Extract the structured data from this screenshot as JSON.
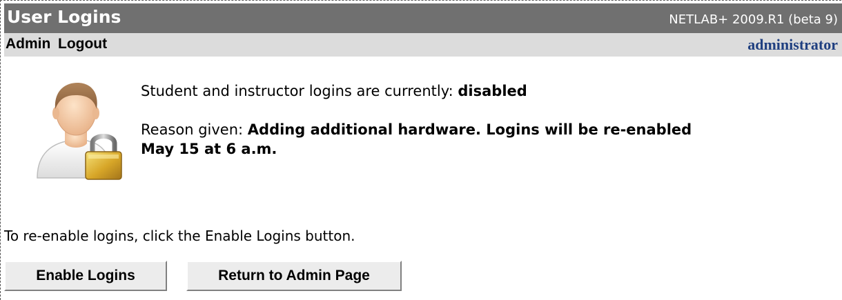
{
  "header": {
    "title": "User Logins",
    "version": "NETLAB+ 2009.R1 (beta 9)"
  },
  "menu": {
    "items": [
      "Admin",
      "Logout"
    ],
    "current_user": "administrator"
  },
  "status": {
    "label": "Student and instructor logins are currently:",
    "value": "disabled"
  },
  "reason": {
    "label": "Reason given:",
    "line1": "Adding additional hardware. Logins will be re-enabled",
    "line2": "May 15 at 6 a.m."
  },
  "instruction": "To re-enable logins, click the Enable Logins button.",
  "buttons": {
    "enable": "Enable Logins",
    "return": "Return to Admin Page"
  },
  "colors": {
    "titlebar": "#707070",
    "menubar": "#dcdcdc",
    "user_link": "#1f3f80"
  },
  "icons": {
    "user": "user-icon",
    "lock": "padlock-icon"
  }
}
